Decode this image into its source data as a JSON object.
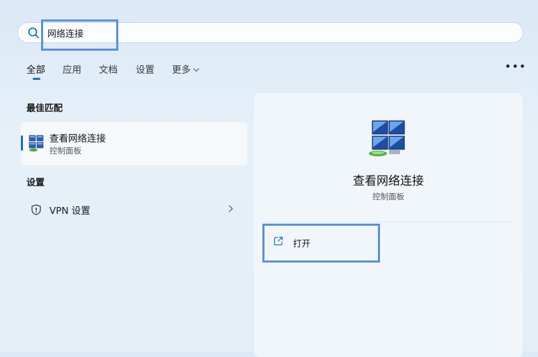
{
  "search": {
    "value": "网络连接"
  },
  "tabs": [
    {
      "label": "全部",
      "active": true
    },
    {
      "label": "应用"
    },
    {
      "label": "文档"
    },
    {
      "label": "设置"
    },
    {
      "label": "更多"
    }
  ],
  "more_menu_label": "•••",
  "best_match": {
    "section_title": "最佳匹配",
    "title": "查看网络连接",
    "subtitle": "控制面板",
    "icon": "network-connections-icon"
  },
  "settings_section": {
    "section_title": "设置",
    "items": [
      {
        "label": "VPN 设置",
        "icon": "shield-icon"
      }
    ]
  },
  "detail": {
    "title": "查看网络连接",
    "subtitle": "控制面板",
    "actions": [
      {
        "label": "打开",
        "icon": "open-external-icon"
      }
    ]
  },
  "colors": {
    "accent": "#1a6fc4",
    "highlight": "#5b8fde"
  }
}
